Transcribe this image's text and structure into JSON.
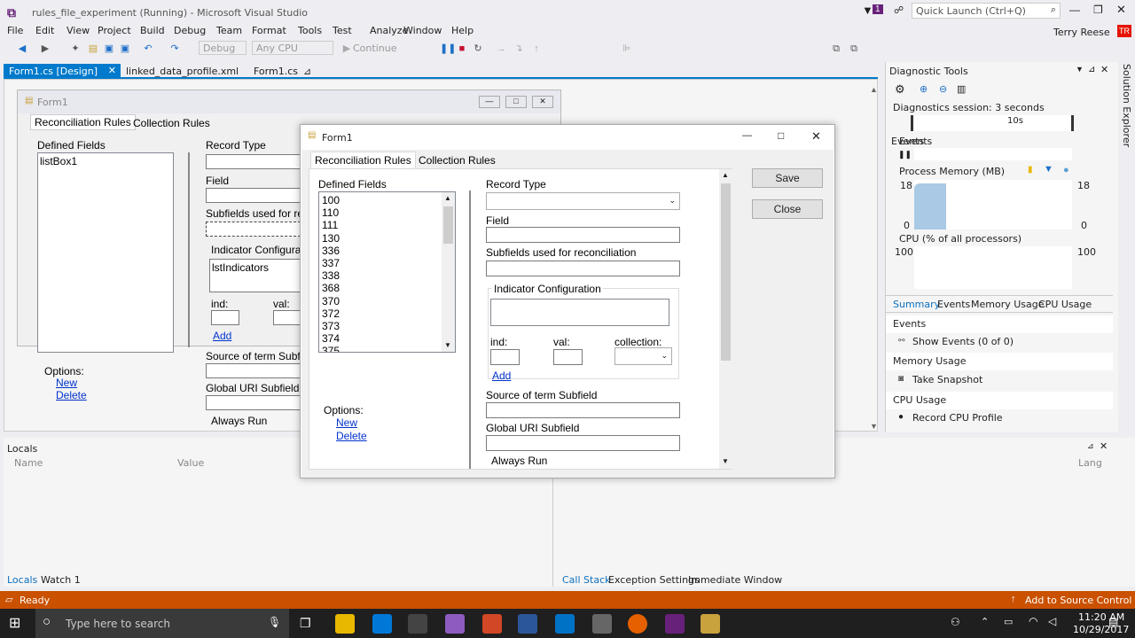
{
  "window": {
    "title": "rules_file_experiment (Running) - Microsoft Visual Studio",
    "notif_count": "1",
    "quick_launch_placeholder": "Quick Launch (Ctrl+Q)",
    "user": "Terry Reese",
    "user_initials": "TR"
  },
  "menu": [
    "File",
    "Edit",
    "View",
    "Project",
    "Build",
    "Debug",
    "Team",
    "Format",
    "Tools",
    "Test",
    "Analyze",
    "Window",
    "Help"
  ],
  "toolbar": {
    "config": "Debug",
    "platform": "Any CPU",
    "continue": "Continue"
  },
  "doc_tabs": [
    {
      "label": "Form1.cs [Design]"
    },
    {
      "label": "linked_data_profile.xml"
    },
    {
      "label": "Form1.cs"
    }
  ],
  "designer": {
    "title": "Form1",
    "tabs": [
      "Reconciliation Rules",
      "Collection Rules"
    ],
    "defined_fields": "Defined Fields",
    "listbox_text": "listBox1",
    "record_type": "Record Type",
    "field": "Field",
    "subfields": "Subfields used for rec",
    "indicator": "Indicator Configurati",
    "lst_indicators": "lstIndicators",
    "ind": "ind:",
    "val": "val:",
    "add": "Add",
    "options": "Options:",
    "new": "New",
    "delete": "Delete",
    "source": "Source of term Subfie",
    "global": "Global URI Subfield",
    "always_run": "Always Run"
  },
  "form": {
    "title": "Form1",
    "tabs": [
      "Reconciliation Rules",
      "Collection Rules"
    ],
    "defined_fields": "Defined Fields",
    "list_items": [
      "100",
      "110",
      "111",
      "130",
      "336",
      "337",
      "338",
      "368",
      "370",
      "372",
      "373",
      "374",
      "375"
    ],
    "record_type": "Record Type",
    "field": "Field",
    "subfields": "Subfields used for reconciliation",
    "indicator": "Indicator Configuration",
    "ind": "ind:",
    "val": "val:",
    "collection": "collection:",
    "add": "Add",
    "source": "Source of term Subfield",
    "global": "Global URI Subfield",
    "always_run": "Always Run",
    "options": "Options:",
    "new": "New",
    "delete": "Delete",
    "save": "Save",
    "close": "Close"
  },
  "diagnostics": {
    "title": "Diagnostic Tools",
    "session": "Diagnostics session: 3 seconds",
    "time_tick": "10s",
    "events": "Events",
    "memory_title": "Process Memory (MB)",
    "mem_max": "18",
    "mem_min": "0",
    "cpu_title": "CPU (% of all processors)",
    "cpu_max": "100",
    "cpu_min": "0",
    "tabs": [
      "Summary",
      "Events",
      "Memory Usage",
      "CPU Usage"
    ],
    "sec_events": "Events",
    "show_events": "Show Events (0 of 0)",
    "sec_memory": "Memory Usage",
    "take_snapshot": "Take Snapshot",
    "sec_cpu": "CPU Usage",
    "record_cpu": "Record CPU Profile",
    "solution_explorer": "Solution Explorer"
  },
  "locals": {
    "title": "Locals",
    "col_name": "Name",
    "col_value": "Value",
    "tabs": [
      "Locals",
      "Watch 1"
    ]
  },
  "callstack": {
    "col_lang": "Lang",
    "tabs": [
      "Call Stack",
      "Exception Settings",
      "Immediate Window"
    ]
  },
  "status": {
    "text": "Ready",
    "source_control": "Add to Source Control"
  },
  "taskbar": {
    "search": "Type here to search",
    "time": "11:20 AM",
    "date": "10/29/2017"
  }
}
